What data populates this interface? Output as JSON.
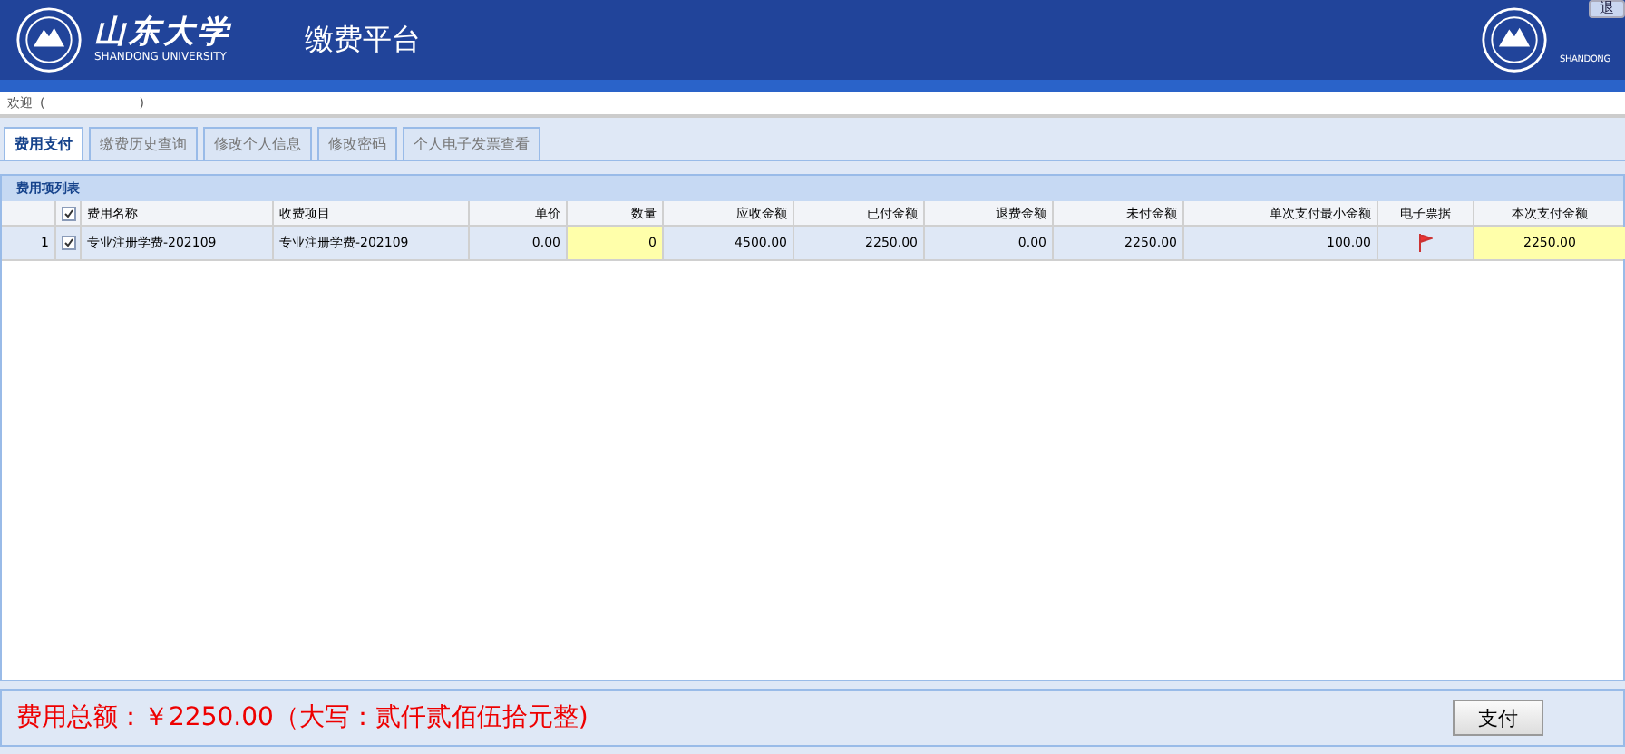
{
  "header": {
    "logo_name": "山东大学",
    "logo_en": "SHANDONG UNIVERSITY",
    "title": "缴费平台",
    "right_logo_en": "SHANDONG",
    "corner_button": "退"
  },
  "welcome": {
    "label": "欢迎",
    "open": "(",
    "close": ")"
  },
  "tabs": [
    {
      "label": "费用支付",
      "selected": true
    },
    {
      "label": "缴费历史查询",
      "selected": false
    },
    {
      "label": "修改个人信息",
      "selected": false
    },
    {
      "label": "修改密码",
      "selected": false
    },
    {
      "label": "个人电子发票查看",
      "selected": false
    }
  ],
  "table": {
    "title": "费用项列表",
    "all_checked": true,
    "columns": [
      {
        "label": "费用名称"
      },
      {
        "label": "收费项目"
      },
      {
        "label": "单价"
      },
      {
        "label": "数量"
      },
      {
        "label": "应收金额"
      },
      {
        "label": "已付金额"
      },
      {
        "label": "退费金额"
      },
      {
        "label": "未付金额"
      },
      {
        "label": "单次支付最小金额"
      },
      {
        "label": "电子票据"
      },
      {
        "label": "本次支付金额"
      }
    ],
    "rows": [
      {
        "index": "1",
        "checked": true,
        "cells": [
          {
            "kind": "text",
            "value": "专业注册学费-202109"
          },
          {
            "kind": "text",
            "value": "专业注册学费-202109"
          },
          {
            "kind": "text",
            "value": "0.00"
          },
          {
            "kind": "input",
            "value": "0"
          },
          {
            "kind": "text",
            "value": "4500.00"
          },
          {
            "kind": "text",
            "value": "2250.00"
          },
          {
            "kind": "text",
            "value": "0.00"
          },
          {
            "kind": "text",
            "value": "2250.00"
          },
          {
            "kind": "text",
            "value": "100.00"
          },
          {
            "kind": "flag"
          },
          {
            "kind": "input",
            "value": "2250.00"
          }
        ]
      }
    ]
  },
  "footer": {
    "total": "费用总额：￥2250.00（大写：贰仟贰佰伍拾元整)",
    "pay_button": "支付"
  }
}
